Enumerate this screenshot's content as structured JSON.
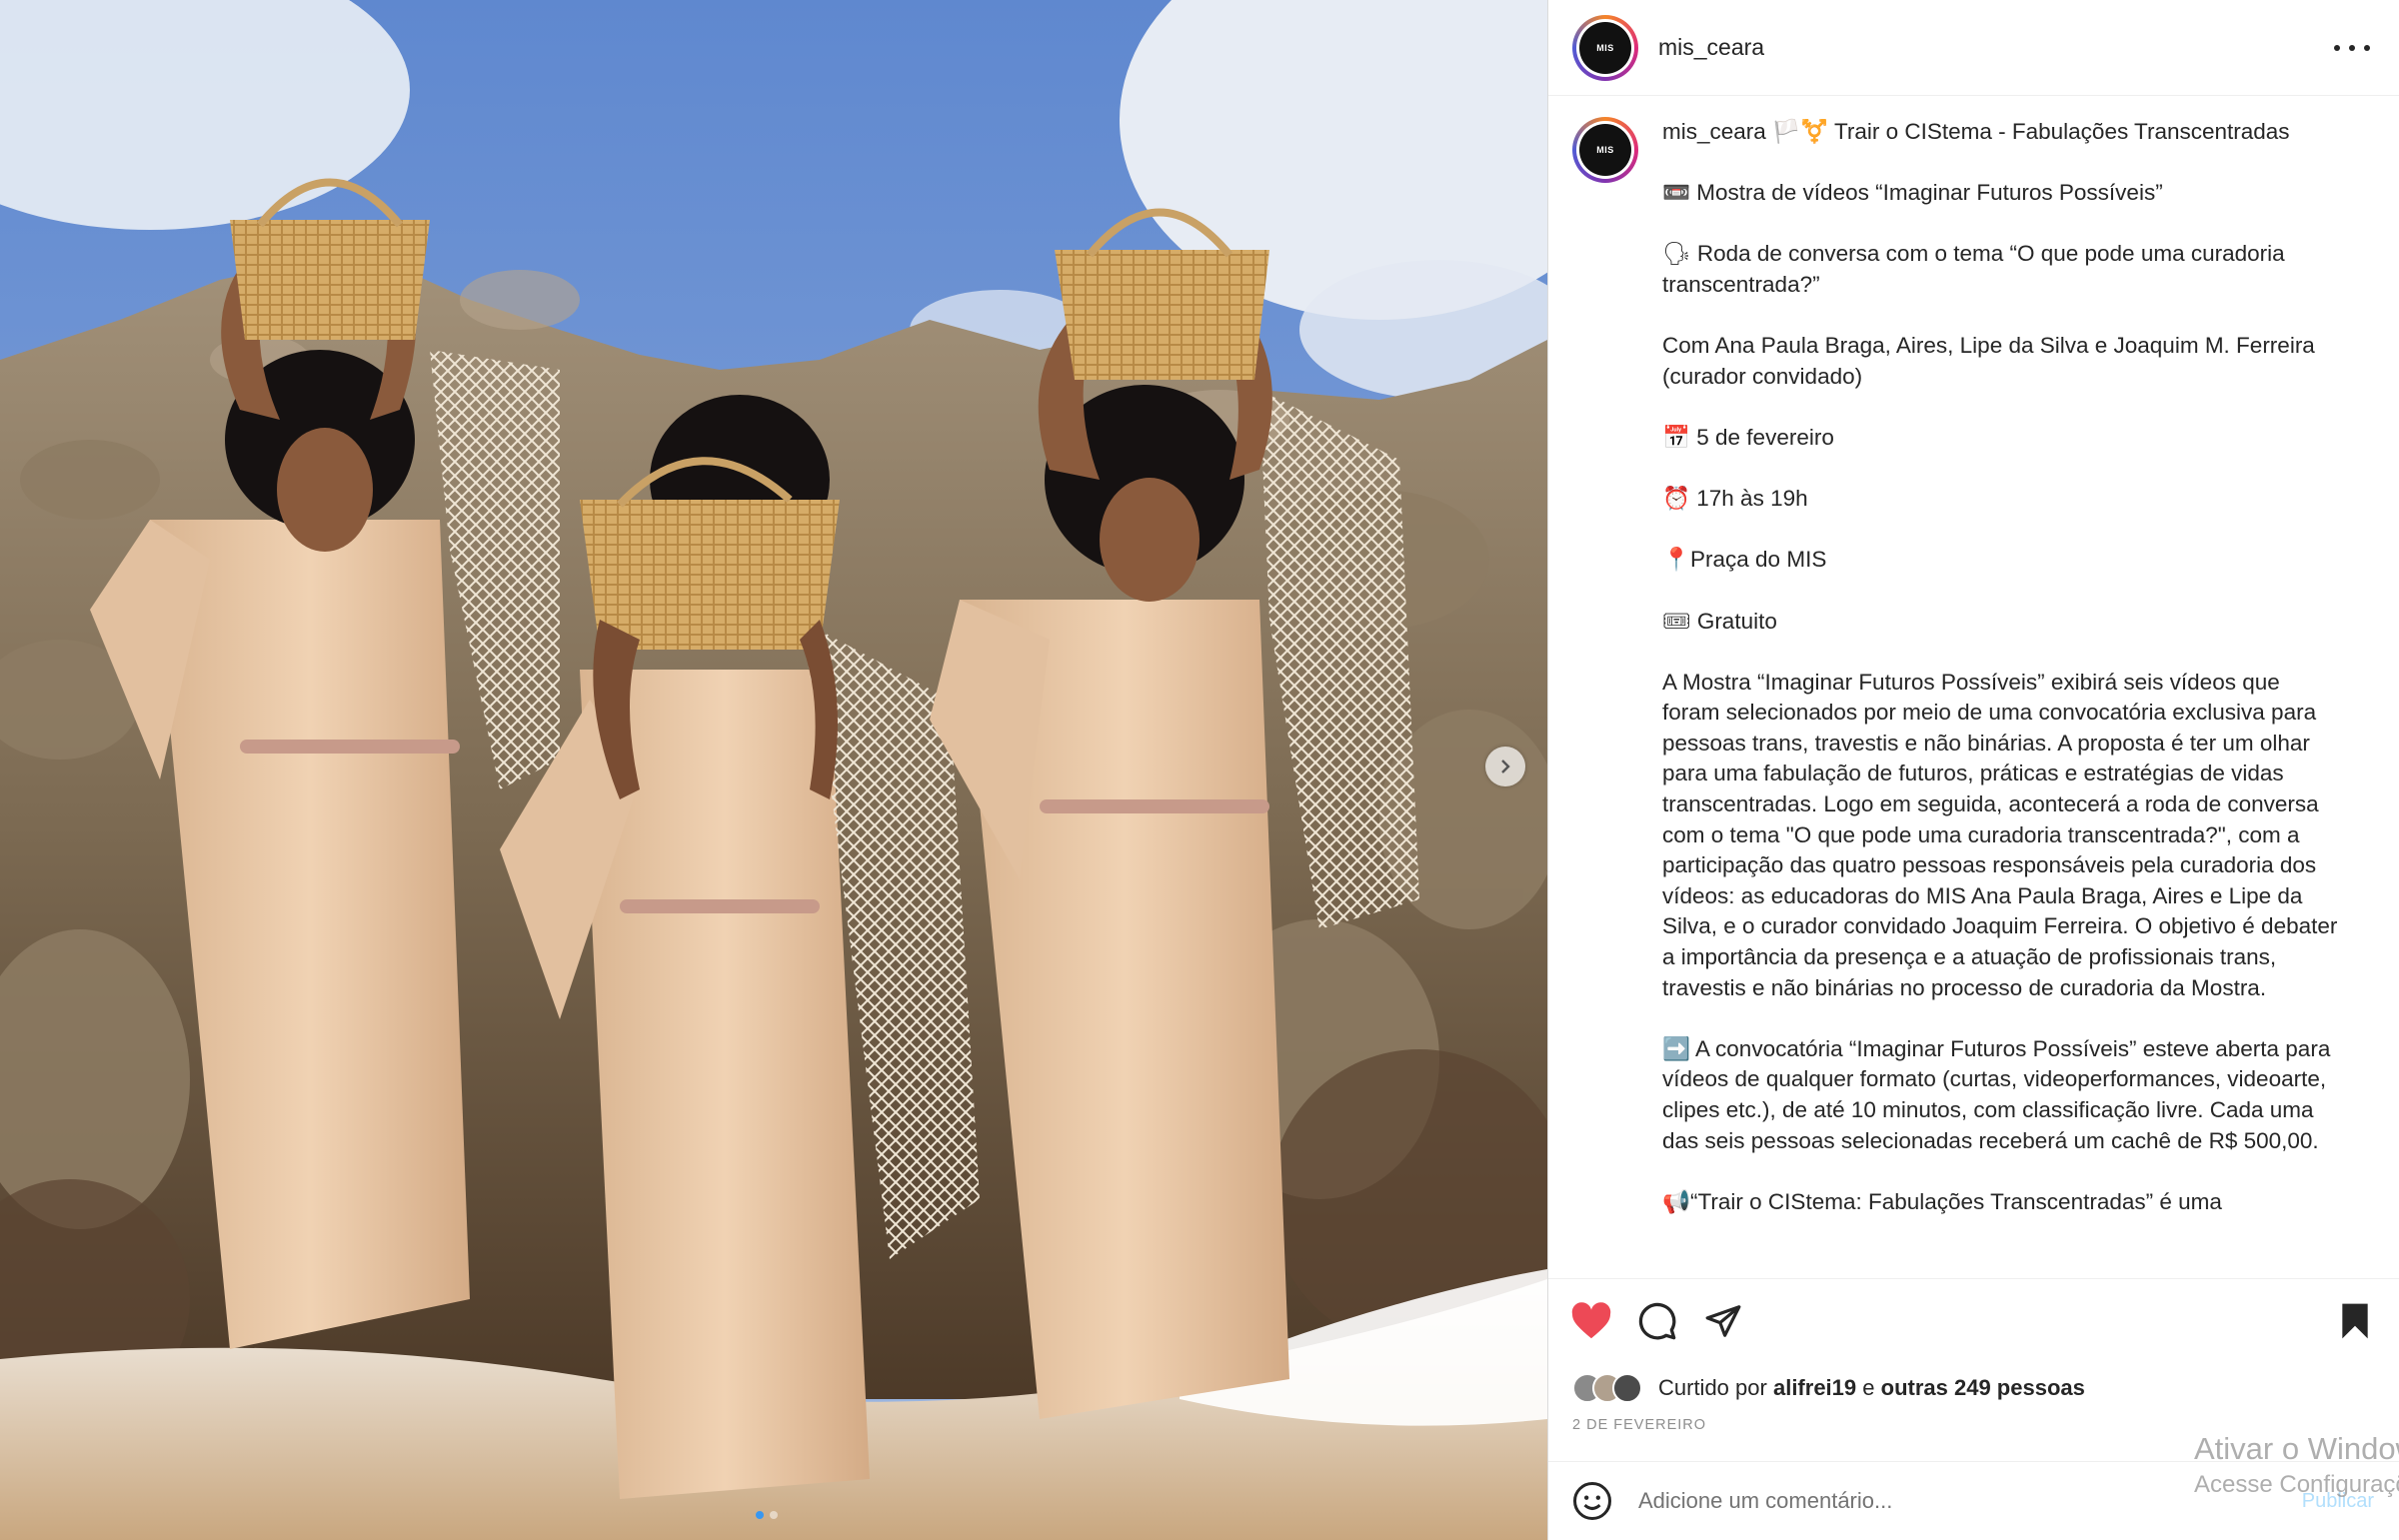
{
  "header": {
    "username": "mis_ceara",
    "avatar_text": "MIS"
  },
  "caption": {
    "username": "mis_ceara",
    "lines": [
      "🏳️⚧️ Trair o CIStema - Fabulações Transcentradas",
      "",
      "📼 Mostra de vídeos “Imaginar Futuros Possíveis”",
      "",
      "🗣 Roda de conversa com o tema “O que pode uma curadoria transcentrada?”",
      "",
      "Com Ana Paula Braga, Aires, Lipe da Silva e Joaquim M. Ferreira (curador convidado)",
      "",
      "📅 5 de fevereiro",
      "",
      "⏰ 17h às 19h",
      "",
      "📍Praça do MIS",
      "",
      "🎟 Gratuito",
      "",
      "A Mostra “Imaginar Futuros Possíveis” exibirá seis vídeos que foram selecionados por meio de uma convocatória exclusiva para pessoas trans, travestis e não binárias. A proposta é ter um olhar para uma fabulação de futuros, práticas e estratégias de vidas transcentradas. Logo em seguida, acontecerá a roda de conversa com o tema \"O que pode uma curadoria transcentrada?\", com a participação das quatro pessoas responsáveis pela curadoria dos vídeos: as educadoras do MIS Ana Paula Braga, Aires e Lipe da Silva, e o curador convidado Joaquim Ferreira. O objetivo é debater a importância da presença e a atuação de profissionais trans, travestis e não binárias no processo de curadoria da Mostra.",
      "",
      "➡️ A convocatória “Imaginar Futuros Possíveis” esteve aberta para vídeos de qualquer formato (curtas, videoperformances, videoarte, clipes etc.), de até 10 minutos, com classificação livre. Cada uma das seis pessoas selecionadas receberá um cachê de R$ 500,00.",
      "",
      "📢“Trair o CIStema: Fabulações Transcentradas” é uma"
    ]
  },
  "likes": {
    "prefix": "Curtido por",
    "user": "alifrei19",
    "middle": "e",
    "rest": "outras 249 pessoas"
  },
  "date": "2 DE FEVEREIRO",
  "comment": {
    "placeholder": "Adicione um comentário...",
    "publish": "Publicar"
  },
  "watermark": {
    "line1": "Ativar o Windows",
    "line2": "Acesse Configurações"
  },
  "colors": {
    "like": "#ed4956",
    "link": "#0095f6",
    "muted": "#8e8e8e"
  },
  "icons": [
    "heart-icon",
    "comment-icon",
    "share-icon",
    "bookmark-icon",
    "emoji-icon",
    "more-icon",
    "chevron-right-icon"
  ]
}
